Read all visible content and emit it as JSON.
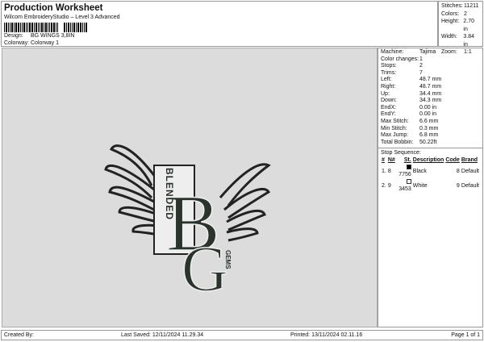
{
  "header": {
    "title": "Production Worksheet",
    "subtitle": "Wilcom EmbroideryStudio – Level 3 Advanced",
    "design_label": "Design:",
    "design_value": "BG WINGS 3,8IN",
    "colorway_label": "Colorway:",
    "colorway_value": "Colorway 1"
  },
  "stats": [
    {
      "label": "Stitches:",
      "value": "11211"
    },
    {
      "label": "Colors:",
      "value": "2"
    },
    {
      "label": "Height:",
      "value": "2.70 in"
    },
    {
      "label": "Width:",
      "value": "3.84 in"
    },
    {
      "label": "Zoom:",
      "value": "1:1"
    }
  ],
  "details": [
    {
      "label": "Machine:",
      "value": "Tajima"
    },
    {
      "label": "Color changes:",
      "value": "1"
    },
    {
      "label": "Stops:",
      "value": "2"
    },
    {
      "label": "Trims:",
      "value": "7"
    },
    {
      "label": "Left:",
      "value": "48.7 mm"
    },
    {
      "label": "Right:",
      "value": "48.7 mm"
    },
    {
      "label": "Up:",
      "value": "34.4 mm"
    },
    {
      "label": "Down:",
      "value": "34.3 mm"
    },
    {
      "label": "EndX:",
      "value": "0.00 in"
    },
    {
      "label": "EndY:",
      "value": "0.00 in"
    },
    {
      "label": "Max Stitch:",
      "value": "6.6 mm"
    },
    {
      "label": "Min Stitch:",
      "value": "0.3 mm"
    },
    {
      "label": "Max Jump:",
      "value": "6.8 mm"
    },
    {
      "label": "Total Bobbin:",
      "value": "50.22ft"
    }
  ],
  "stop_sequence": {
    "title": "Stop Sequence:",
    "columns": [
      "#",
      "N#",
      "St.",
      "Description",
      "Code",
      "Brand"
    ],
    "rows": [
      {
        "idx": "1.",
        "n": "8",
        "color": "#000000",
        "st": "7756",
        "desc": "Black",
        "code": "8",
        "brand": "Default"
      },
      {
        "idx": "2.",
        "n": "9",
        "color": "#ffffff",
        "st": "3453",
        "desc": "White",
        "code": "9",
        "brand": "Default"
      }
    ]
  },
  "logo_text": {
    "big_b": "B",
    "big_g": "G",
    "side1": "BLENDED",
    "side2": "GEMS"
  },
  "footer": {
    "created": "Created By:",
    "saved": "Last Saved: 12/11/2024 11.29.34",
    "printed": "Printed: 13/11/2024 02.11.16",
    "page": "Page 1 of 1"
  }
}
